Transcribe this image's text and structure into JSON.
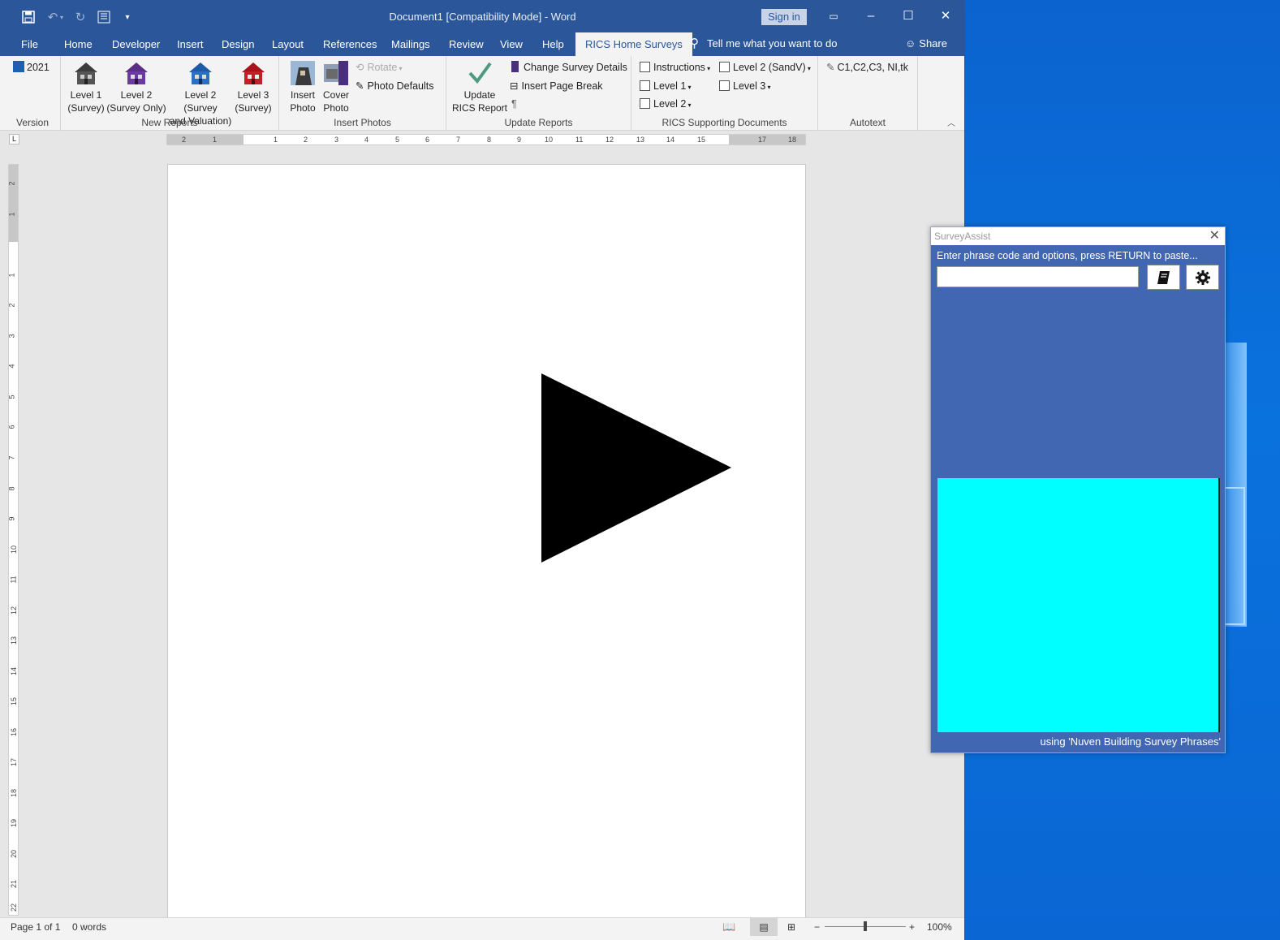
{
  "window": {
    "title": "Document1 [Compatibility Mode] - Word",
    "sign_in": "Sign in",
    "tell_me": "Tell me what you want to do",
    "share": "Share"
  },
  "tabs": [
    "File",
    "Home",
    "Developer",
    "Insert",
    "Design",
    "Layout",
    "References",
    "Mailings",
    "Review",
    "View",
    "Help",
    "RICS Home Surveys"
  ],
  "active_tab": "RICS Home Surveys",
  "ribbon": {
    "version": {
      "button": "2021",
      "label": "Version"
    },
    "new_reports": {
      "label": "New Reports",
      "level1": [
        "Level 1",
        "(Survey)"
      ],
      "level2": [
        "Level 2",
        "(Survey Only)"
      ],
      "level2v": [
        "Level 2 (Survey",
        "and Valuation)"
      ],
      "level3": [
        "Level 3",
        "(Survey)"
      ]
    },
    "insert_photos": {
      "label": "Insert Photos",
      "insert_photo": [
        "Insert",
        "Photo"
      ],
      "cover_photo": [
        "Cover",
        "Photo"
      ],
      "rotate": "Rotate",
      "photo_defaults": "Photo Defaults"
    },
    "update_reports": {
      "label": "Update Reports",
      "update": [
        "Update",
        "RICS Report"
      ],
      "change_details": "Change Survey Details",
      "page_break": "Insert Page Break",
      "pilcrow": "¶"
    },
    "supporting": {
      "label": "RICS Supporting Documents",
      "instructions": "Instructions",
      "level1": "Level 1",
      "level2": "Level 2",
      "level2sandv": "Level 2 (SandV)",
      "level3": "Level 3"
    },
    "autotext": {
      "label": "Autotext",
      "item": "C1,C2,C3, NI,tk"
    }
  },
  "ruler": {
    "h": [
      "2",
      "1",
      "1",
      "2",
      "3",
      "4",
      "5",
      "6",
      "7",
      "8",
      "9",
      "10",
      "11",
      "12",
      "13",
      "14",
      "15",
      "17",
      "18"
    ],
    "v": [
      "2",
      "1",
      "1",
      "2",
      "3",
      "4",
      "5",
      "6",
      "7",
      "8",
      "9",
      "10",
      "11",
      "12",
      "13",
      "14",
      "15",
      "16",
      "17",
      "18",
      "19",
      "20",
      "21",
      "22"
    ]
  },
  "status": {
    "page": "Page 1 of 1",
    "words": "0 words",
    "zoom": "100%",
    "zoom_level": 1.0
  },
  "survey_assist": {
    "title": "SurveyAssist",
    "prompt": "Enter phrase code and options, press RETURN to paste...",
    "input_value": "",
    "footer": "using 'Nuven Building Survey Phrases'",
    "panel_color": "#00ffff"
  },
  "colors": {
    "accent": "#2b579a",
    "panel_bg": "#4267b2"
  }
}
